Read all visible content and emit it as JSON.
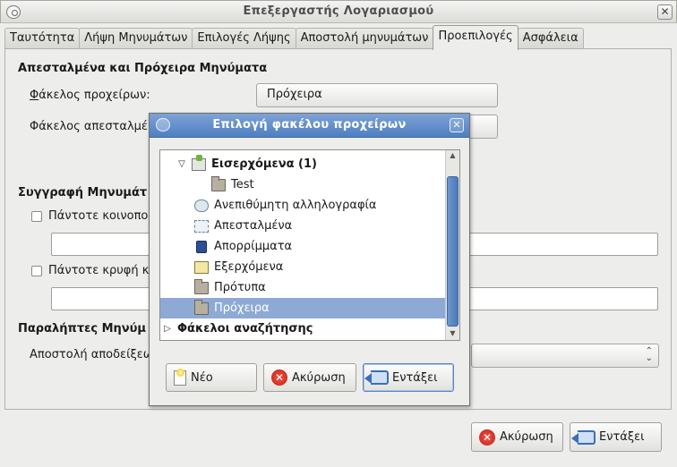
{
  "window": {
    "title": "Επεξεργαστής Λογαριασμού",
    "close_glyph": "✕",
    "icon": "mail-account-icon"
  },
  "tabs": [
    {
      "label": "Ταυτότητα",
      "active": false
    },
    {
      "label": "Λήψη Μηνυμάτων",
      "active": false
    },
    {
      "label": "Επιλογές Λήψης",
      "active": false
    },
    {
      "label": "Αποστολή μηνυμάτων",
      "active": false
    },
    {
      "label": "Προεπιλογές",
      "active": true
    },
    {
      "label": "Ασφάλεια",
      "active": false
    }
  ],
  "sent_drafts": {
    "heading": "Απεσταλμένα και Πρόχειρα Μηνύματα",
    "drafts_label": "Φάκελος προχείρων:",
    "drafts_button": "Πρόχειρα",
    "sent_label": "Φάκελος απεσταλμέ"
  },
  "compose": {
    "heading": "Συγγραφή Μηνυμάτ",
    "always_cc_label": "Πάντοτε κοινοπο",
    "always_cc_checked": false,
    "always_cc_value": "",
    "always_bcc_label": "Πάντοτε κρυφή κ",
    "always_bcc_checked": false,
    "always_bcc_value": ""
  },
  "receipts": {
    "heading": "Παραλήπτες  Μηνύμ",
    "send_receipts_label": "Αποστολή αποδείξεω"
  },
  "footer": {
    "cancel": "Ακύρωση",
    "ok": "Εντάξει"
  },
  "dialog": {
    "title": "Επιλογή φακέλου προχείρων",
    "close_glyph": "✕",
    "folders": [
      {
        "label": "Εισερχόμενα (1)",
        "bold": true,
        "expander": "▽",
        "icon": "inbox-icon",
        "level": 1
      },
      {
        "label": "Test",
        "bold": false,
        "icon": "folder-icon",
        "level": 2
      },
      {
        "label": "Ανεπιθύμητη αλληλογραφία",
        "bold": false,
        "icon": "junk-icon",
        "level": 1
      },
      {
        "label": "Απεσταλμένα",
        "bold": false,
        "icon": "sent-icon",
        "level": 1
      },
      {
        "label": "Απορρίμματα",
        "bold": false,
        "icon": "trash-icon",
        "level": 1
      },
      {
        "label": "Εξερχόμενα",
        "bold": false,
        "icon": "outbox-icon",
        "level": 1
      },
      {
        "label": "Πρότυπα",
        "bold": false,
        "icon": "folder-icon",
        "level": 1
      },
      {
        "label": "Πρόχειρα",
        "bold": false,
        "icon": "folder-icon",
        "level": 1,
        "selected": true
      },
      {
        "label": "Φάκελοι αναζήτησης",
        "bold": true,
        "expander": "▷",
        "level": 0
      }
    ],
    "buttons": {
      "new": "Νέο",
      "cancel": "Ακύρωση",
      "ok": "Εντάξει"
    }
  },
  "colors": {
    "selection": "#8eaad4",
    "dialog_title": "#5a87c6",
    "cancel_icon": "#d42a1e"
  }
}
